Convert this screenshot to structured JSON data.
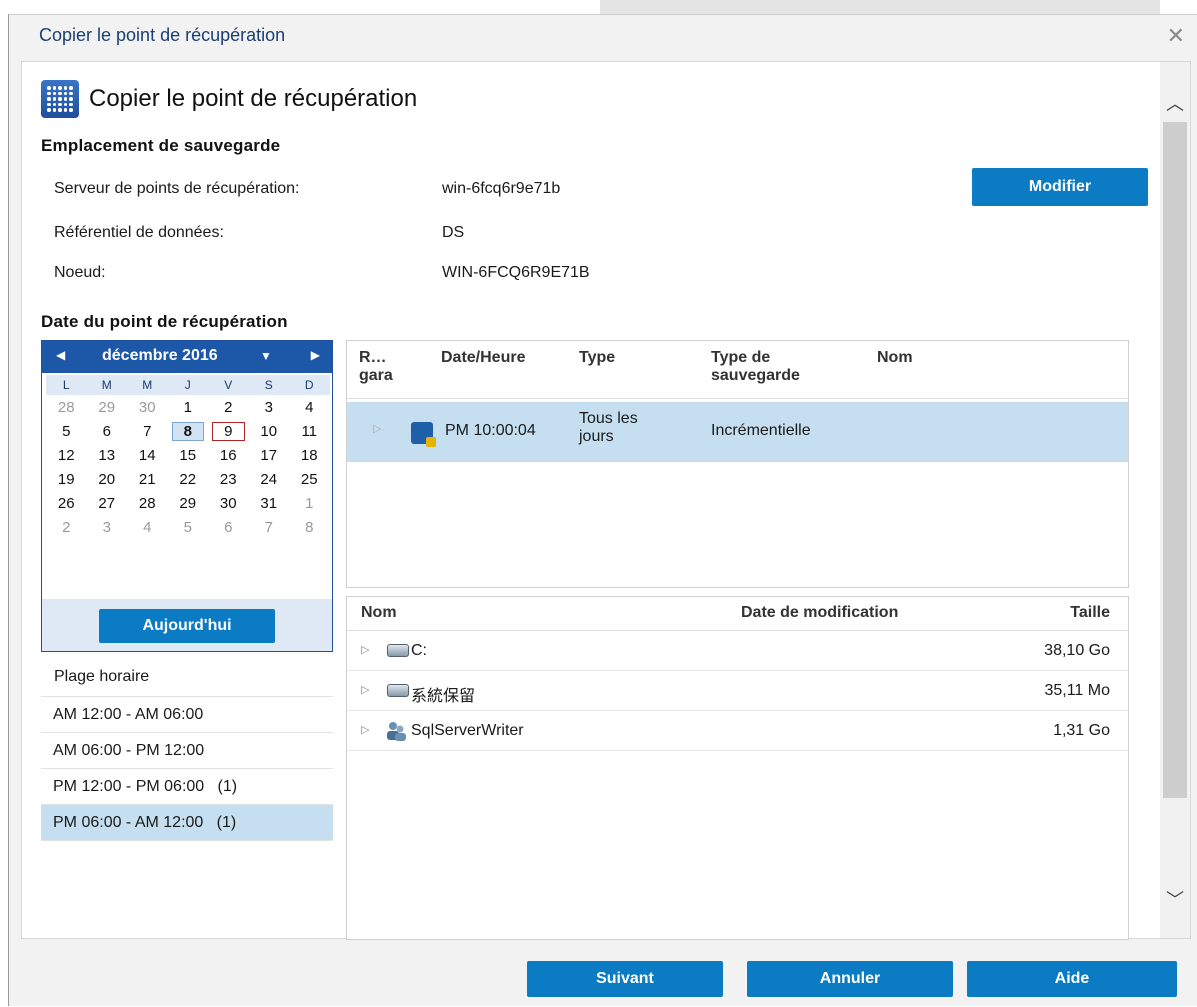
{
  "window": {
    "title": "Copier le point de récupération",
    "close_glyph": "✕"
  },
  "heading": {
    "title": "Copier le point de récupération"
  },
  "backup_location": {
    "section_label": "Emplacement de sauvegarde",
    "server_label": "Serveur de points de récupération:",
    "server_value": "win-6fcq6r9e71b",
    "datastore_label": "Référentiel de données:",
    "datastore_value": "DS",
    "node_label": "Noeud:",
    "node_value": "WIN-6FCQ6R9E71B",
    "modify_button": "Modifier"
  },
  "recovery_date": {
    "section_label": "Date du point de récupération",
    "calendar": {
      "month_label": "décembre 2016",
      "weekdays": [
        "L",
        "M",
        "M",
        "J",
        "V",
        "S",
        "D"
      ],
      "weeks": [
        [
          {
            "d": "28",
            "o": true
          },
          {
            "d": "29",
            "o": true
          },
          {
            "d": "30",
            "o": true
          },
          {
            "d": "1"
          },
          {
            "d": "2"
          },
          {
            "d": "3"
          },
          {
            "d": "4"
          }
        ],
        [
          {
            "d": "5"
          },
          {
            "d": "6"
          },
          {
            "d": "7"
          },
          {
            "d": "8",
            "sel": true
          },
          {
            "d": "9",
            "today": true
          },
          {
            "d": "10"
          },
          {
            "d": "11"
          }
        ],
        [
          {
            "d": "12"
          },
          {
            "d": "13"
          },
          {
            "d": "14"
          },
          {
            "d": "15"
          },
          {
            "d": "16"
          },
          {
            "d": "17"
          },
          {
            "d": "18"
          }
        ],
        [
          {
            "d": "19"
          },
          {
            "d": "20"
          },
          {
            "d": "21"
          },
          {
            "d": "22"
          },
          {
            "d": "23"
          },
          {
            "d": "24"
          },
          {
            "d": "25"
          }
        ],
        [
          {
            "d": "26"
          },
          {
            "d": "27"
          },
          {
            "d": "28"
          },
          {
            "d": "29"
          },
          {
            "d": "30"
          },
          {
            "d": "31"
          },
          {
            "d": "1",
            "o": true
          }
        ],
        [
          {
            "d": "2",
            "o": true
          },
          {
            "d": "3",
            "o": true
          },
          {
            "d": "4",
            "o": true
          },
          {
            "d": "5",
            "o": true
          },
          {
            "d": "6",
            "o": true
          },
          {
            "d": "7",
            "o": true
          },
          {
            "d": "8",
            "o": true
          }
        ]
      ],
      "today_button": "Aujourd'hui"
    },
    "time_range_label": "Plage horaire",
    "time_ranges": [
      {
        "label": "AM 12:00 - AM 06:00",
        "selected": false
      },
      {
        "label": "AM 06:00 - PM 12:00",
        "selected": false
      },
      {
        "label": "PM 12:00 - PM 06:00   (1)",
        "selected": false
      },
      {
        "label": "PM 06:00 - AM 12:00   (1)",
        "selected": true
      }
    ]
  },
  "recovery_points": {
    "columns": {
      "r": "R…\ngara",
      "datetime": "Date/Heure",
      "type": "Type",
      "backup_type": "Type de\nsauvegarde",
      "name": "Nom"
    },
    "rows": [
      {
        "datetime": "PM 10:00:04",
        "type": "Tous les\njours",
        "backup_type": "Incrémentielle",
        "name": "",
        "icon": "backup-point-icon"
      }
    ]
  },
  "files": {
    "columns": {
      "name": "Nom",
      "modified": "Date de modification",
      "size": "Taille"
    },
    "rows": [
      {
        "name": "C:",
        "modified": "",
        "size": "38,10 Go",
        "icon": "drive-icon"
      },
      {
        "name": "系統保留",
        "modified": "",
        "size": "35,11 Mo",
        "icon": "drive-icon"
      },
      {
        "name": "SqlServerWriter",
        "modified": "",
        "size": "1,31 Go",
        "icon": "users-icon"
      }
    ]
  },
  "footer": {
    "next": "Suivant",
    "cancel": "Annuler",
    "help": "Aide"
  },
  "colors": {
    "accent": "#0b7bc4",
    "calendar_header": "#1d57a8",
    "selection": "#c5dff0",
    "title": "#1b3f73"
  }
}
